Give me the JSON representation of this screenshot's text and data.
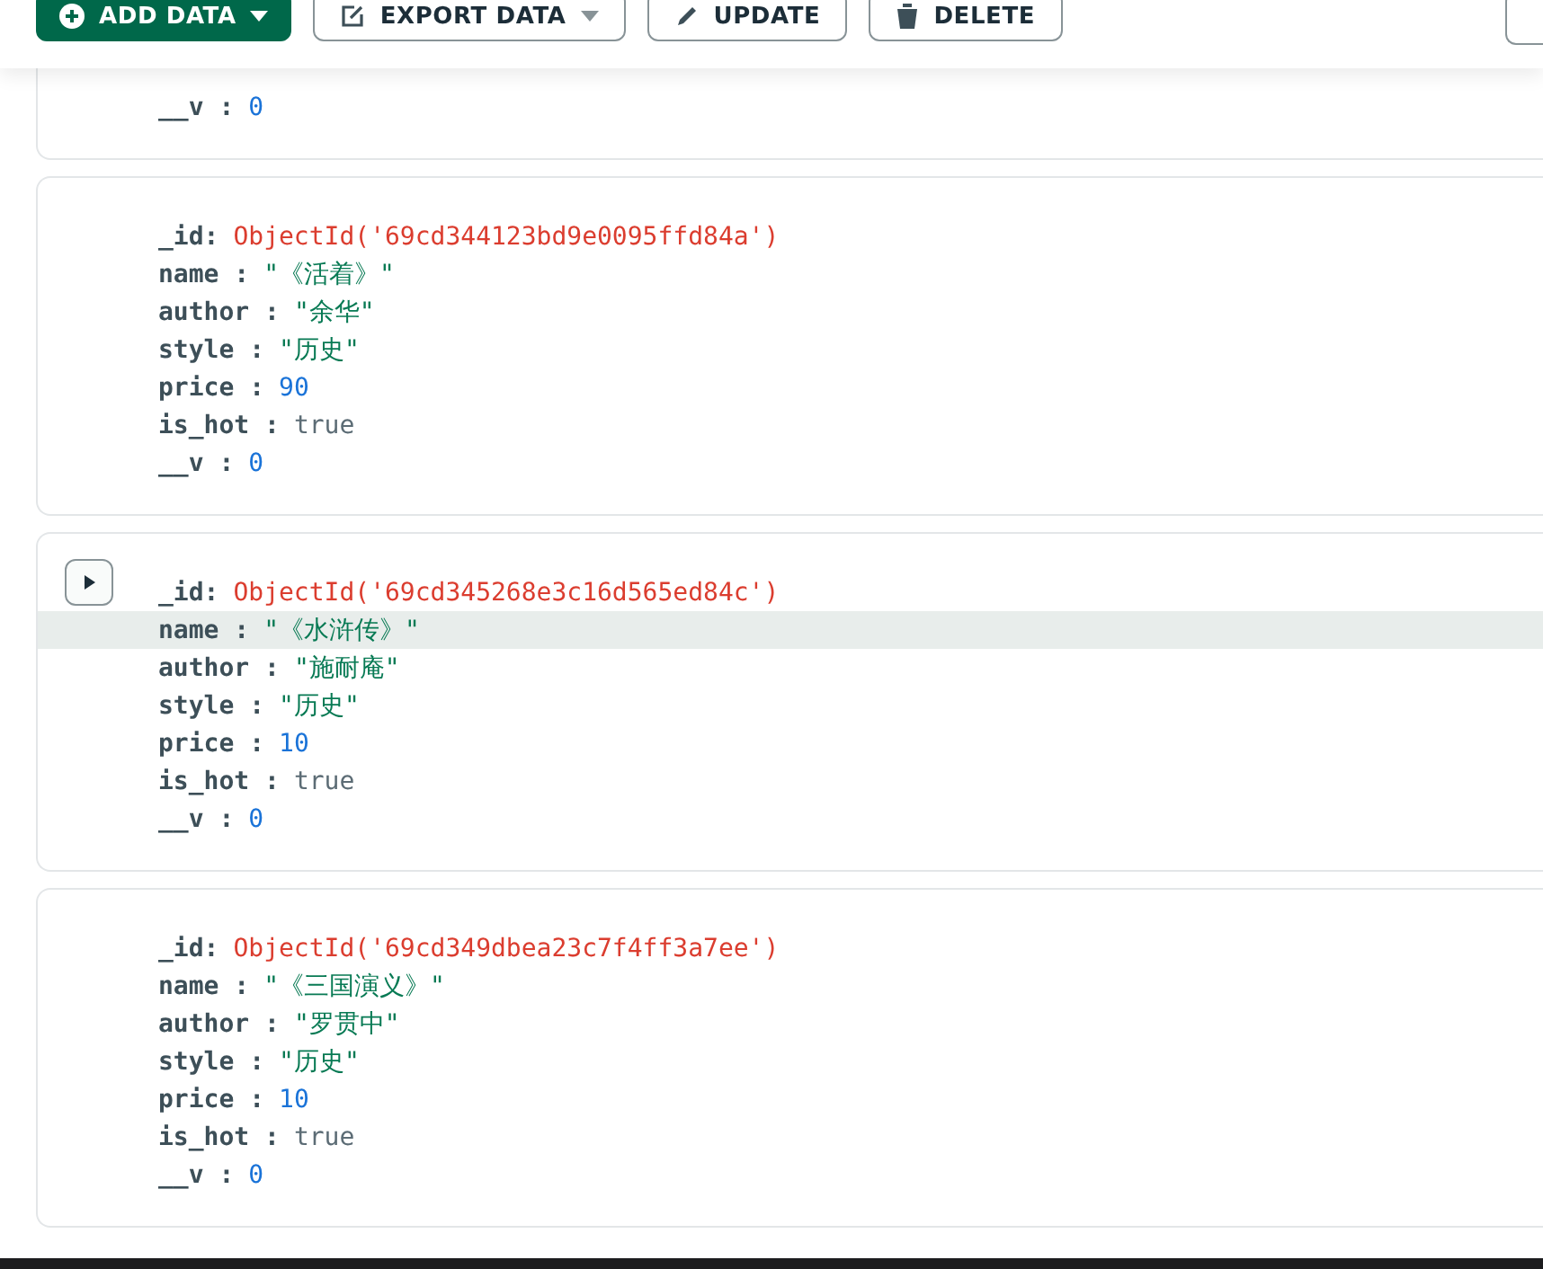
{
  "toolbar": {
    "buttons": [
      {
        "label": "ADD DATA",
        "kind": "primary",
        "caret": true
      },
      {
        "label": "EXPORT DATA",
        "kind": "export",
        "caret": true
      },
      {
        "label": "UPDATE",
        "kind": "update",
        "caret": false
      },
      {
        "label": "DELETE",
        "kind": "delete",
        "caret": false
      }
    ]
  },
  "documents": [
    {
      "expand_button": false,
      "fields": [
        {
          "key": "__v :",
          "value": "0",
          "kind": "number",
          "highlighted": false
        }
      ]
    },
    {
      "expand_button": false,
      "fields": [
        {
          "key": "_id:",
          "value": "ObjectId('69cd344123bd9e0095ffd84a')",
          "kind": "objectid",
          "highlighted": false
        },
        {
          "key": "name :",
          "value": "\"《活着》\"",
          "kind": "string",
          "highlighted": false
        },
        {
          "key": "author :",
          "value": "\"余华\"",
          "kind": "string",
          "highlighted": false
        },
        {
          "key": "style :",
          "value": "\"历史\"",
          "kind": "string",
          "highlighted": false
        },
        {
          "key": "price :",
          "value": "90",
          "kind": "number",
          "highlighted": false
        },
        {
          "key": "is_hot :",
          "value": "true",
          "kind": "boolean",
          "highlighted": false
        },
        {
          "key": "__v :",
          "value": "0",
          "kind": "number",
          "highlighted": false
        }
      ]
    },
    {
      "expand_button": true,
      "fields": [
        {
          "key": "_id:",
          "value": "ObjectId('69cd345268e3c16d565ed84c')",
          "kind": "objectid",
          "highlighted": false
        },
        {
          "key": "name :",
          "value": "\"《水浒传》\"",
          "kind": "string",
          "highlighted": true
        },
        {
          "key": "author :",
          "value": "\"施耐庵\"",
          "kind": "string",
          "highlighted": false
        },
        {
          "key": "style :",
          "value": "\"历史\"",
          "kind": "string",
          "highlighted": false
        },
        {
          "key": "price :",
          "value": "10",
          "kind": "number",
          "highlighted": false
        },
        {
          "key": "is_hot :",
          "value": "true",
          "kind": "boolean",
          "highlighted": false
        },
        {
          "key": "__v :",
          "value": "0",
          "kind": "number",
          "highlighted": false
        }
      ]
    },
    {
      "expand_button": false,
      "fields": [
        {
          "key": "_id:",
          "value": "ObjectId('69cd349dbea23c7f4ff3a7ee')",
          "kind": "objectid",
          "highlighted": false
        },
        {
          "key": "name :",
          "value": "\"《三国演义》\"",
          "kind": "string",
          "highlighted": false
        },
        {
          "key": "author :",
          "value": "\"罗贯中\"",
          "kind": "string",
          "highlighted": false
        },
        {
          "key": "style :",
          "value": "\"历史\"",
          "kind": "string",
          "highlighted": false
        },
        {
          "key": "price :",
          "value": "10",
          "kind": "number",
          "highlighted": false
        },
        {
          "key": "is_hot :",
          "value": "true",
          "kind": "boolean",
          "highlighted": false
        },
        {
          "key": "__v :",
          "value": "0",
          "kind": "number",
          "highlighted": false
        }
      ]
    }
  ]
}
